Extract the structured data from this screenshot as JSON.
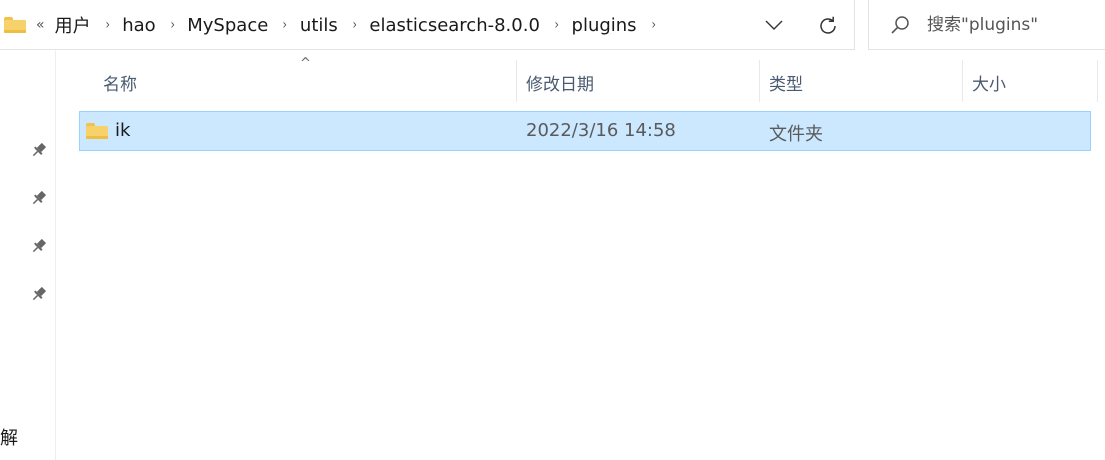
{
  "address": {
    "overflow_glyph": "«",
    "crumbs": [
      "用户",
      "hao",
      "MySpace",
      "utils",
      "elasticsearch-8.0.0",
      "plugins"
    ],
    "separator": "›"
  },
  "search": {
    "placeholder": "搜索\"plugins\""
  },
  "columns": {
    "name": "名称",
    "modified": "修改日期",
    "type": "类型",
    "size": "大小",
    "sort_glyph": "^"
  },
  "rows": [
    {
      "name": "ik",
      "modified": "2022/3/16 14:58",
      "type": "文件夹",
      "size": ""
    }
  ],
  "nav_pane": {
    "pins": 4,
    "partial_label": "解"
  },
  "icons": {
    "folder": "folder-icon",
    "dropdown": "chevron-down-icon",
    "refresh": "refresh-icon",
    "search": "search-icon",
    "pin": "pin-icon"
  },
  "colors": {
    "selection_bg": "#cce8ff",
    "selection_border": "#99d1ff",
    "folder": "#f7d26b",
    "header_text": "#4a5a70"
  }
}
